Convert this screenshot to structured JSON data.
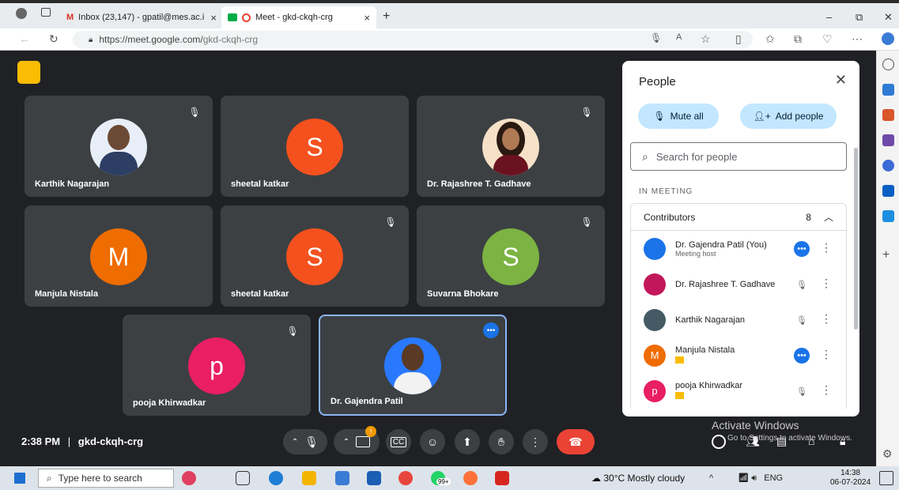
{
  "browser": {
    "tabs": [
      {
        "label": "Inbox (23,147) - gpatil@mes.ac.i"
      },
      {
        "label": "Meet - gkd-ckqh-crg"
      }
    ],
    "url_host": "https://meet.google.com/",
    "url_path": "gkd-ckqh-crg",
    "new_tab": "+",
    "close": "×",
    "window_controls": {
      "minimize": "–",
      "restore": "⧉",
      "close": "✕"
    }
  },
  "tiles": [
    {
      "name": "Karthik Nagarajan",
      "avatar": "photo",
      "color": "#e8eef7"
    },
    {
      "name": "sheetal katkar",
      "initial": "S",
      "color": "#f4511e"
    },
    {
      "name": "Dr. Rajashree T. Gadhave",
      "avatar": "photo",
      "color": "#f6e1c8"
    },
    {
      "name": "Manjula Nistala",
      "initial": "M",
      "color": "#ef6c00"
    },
    {
      "name": "sheetal katkar",
      "initial": "S",
      "color": "#f4511e"
    },
    {
      "name": "Suvarna Bhokare",
      "initial": "S",
      "color": "#7cb342"
    },
    {
      "name": "pooja Khirwadkar",
      "initial": "p",
      "color": "#e91e63"
    },
    {
      "name": "Dr. Gajendra Patil",
      "avatar": "photo",
      "color": "#2979ff"
    }
  ],
  "meeting": {
    "time": "2:38 PM",
    "code": "gkd-ckqh-crg"
  },
  "people_panel": {
    "title": "People",
    "mute_all": "Mute all",
    "add_people": "Add people",
    "search_placeholder": "Search for people",
    "section": "IN MEETING",
    "contributors_label": "Contributors",
    "contributors_count": "8",
    "participants": [
      {
        "name": "Dr. Gajendra Patil (You)",
        "sub": "Meeting host",
        "avatar": "photo",
        "color": "#1a73e8"
      },
      {
        "name": "Dr. Rajashree T. Gadhave",
        "sub": "",
        "avatar": "photo",
        "color": "#c2185b"
      },
      {
        "name": "Karthik Nagarajan",
        "sub": "",
        "avatar": "photo",
        "color": "#455a64"
      },
      {
        "name": "Manjula Nistala",
        "sub": "",
        "initial": "M",
        "color": "#ef6c00"
      },
      {
        "name": "pooja Khirwadkar",
        "sub": "",
        "initial": "p",
        "color": "#e91e63"
      }
    ]
  },
  "watermark": {
    "line1": "Activate Windows",
    "line2": "Go to Settings to activate Windows."
  },
  "taskbar": {
    "search_placeholder": "Type here to search",
    "weather": "30°C  Mostly cloudy",
    "lang": "ENG",
    "time": "14:38",
    "date": "06-07-2024",
    "whatsapp_badge": "99+"
  }
}
